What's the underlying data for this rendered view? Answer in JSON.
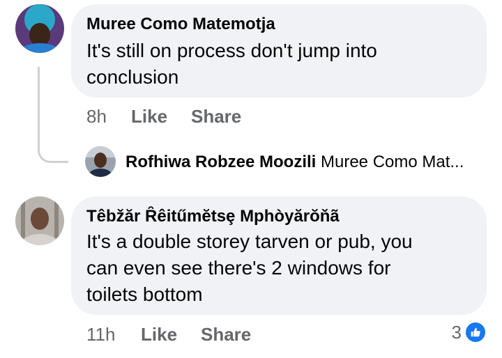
{
  "comments": [
    {
      "author": "Muree Como Matemotja",
      "text_lines": [
        "It's still on process don't jump into",
        "conclusion"
      ],
      "time": "8h",
      "like_label": "Like",
      "share_label": "Share"
    },
    {
      "author": "Têbžăr Ȓêitűmĕtsȩ Mphòyărŏňã",
      "text_lines": [
        "It's a double storey tarven or pub, you",
        "can even see there's 2 windows for",
        "toilets bottom"
      ],
      "time": "11h",
      "like_label": "Like",
      "share_label": "Share",
      "reaction_count": "3"
    }
  ],
  "reply_preview": {
    "author": "Rofhiwa Robzee Moozili",
    "snippet": "Muree Como Mat..."
  },
  "colors": {
    "bubble": "#f0f2f5",
    "secondary_text": "#65676b",
    "like_blue": "#1877f2"
  },
  "icons": {
    "like_reaction": "thumbs-up-icon"
  }
}
